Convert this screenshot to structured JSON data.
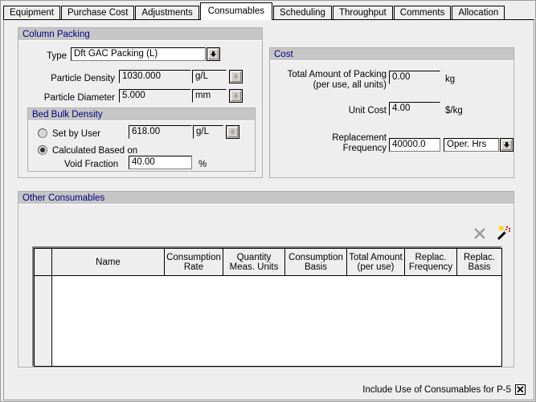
{
  "tabs": [
    {
      "label": "Equipment",
      "active": false
    },
    {
      "label": "Purchase Cost",
      "active": false
    },
    {
      "label": "Adjustments",
      "active": false
    },
    {
      "label": "Consumables",
      "active": true
    },
    {
      "label": "Scheduling",
      "active": false
    },
    {
      "label": "Throughput",
      "active": false
    },
    {
      "label": "Comments",
      "active": false
    },
    {
      "label": "Allocation",
      "active": false
    }
  ],
  "column_packing": {
    "title": "Column Packing",
    "type_label": "Type",
    "type_value": "Dft GAC Packing (L)",
    "type_dropdown_icon": "chevron-down-icon",
    "particle_density_label": "Particle Density",
    "particle_density_value": "1030.000",
    "particle_density_unit": "g/L",
    "particle_diameter_label": "Particle Diameter",
    "particle_diameter_value": "5.000",
    "particle_diameter_unit": "mm",
    "unit_button_icon": "down-arrow-icon"
  },
  "bed_bulk_density": {
    "title": "Bed Bulk Density",
    "set_by_user_label": "Set by User",
    "set_by_user_selected": false,
    "set_by_user_value": "618.00",
    "set_by_user_unit": "g/L",
    "calculated_label": "Calculated Based on",
    "calculated_selected": true,
    "void_fraction_label": "Void Fraction",
    "void_fraction_value": "40.00",
    "void_fraction_unit": "%"
  },
  "cost": {
    "title": "Cost",
    "total_amount_label_line1": "Total Amount of Packing",
    "total_amount_label_line2": "(per use, all units)",
    "total_amount_value": "0.00",
    "total_amount_unit": "kg",
    "unit_cost_label": "Unit Cost",
    "unit_cost_value": "4.00",
    "unit_cost_unit": "$/kg",
    "replacement_label_line1": "Replacement",
    "replacement_label_line2": "Frequency",
    "replacement_value": "40000.0",
    "replacement_basis": "Oper. Hrs",
    "replacement_dropdown_icon": "chevron-down-icon"
  },
  "other_consumables": {
    "title": "Other Consumables",
    "delete_icon": "x-delete-icon",
    "wand_icon": "magic-wand-icon",
    "columns": [
      "",
      "Name",
      "Consumption\nRate",
      "Quantity\nMeas. Units",
      "Consumption\nBasis",
      "Total Amount\n(per use)",
      "Replac.\nFrequency",
      "Replac.\nBasis",
      ""
    ],
    "rows": []
  },
  "bottom": {
    "include_label": "Include Use of Consumables for P-5",
    "include_checked": true
  },
  "colors": {
    "group_title_text": "#000080",
    "group_title_bg": "#c6c6c6",
    "panel_bg": "#eeeeee"
  }
}
